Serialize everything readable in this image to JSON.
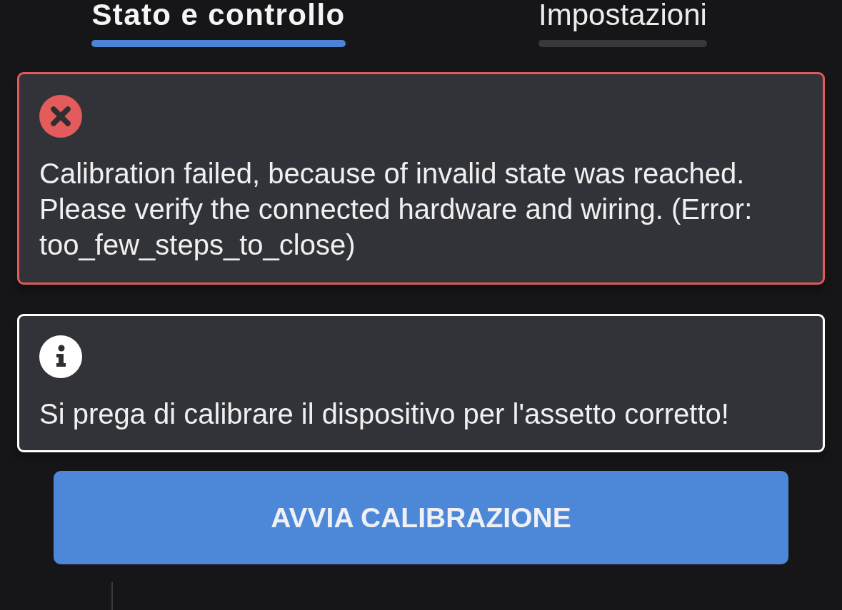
{
  "tabs": [
    {
      "label": "Stato e controllo",
      "selected": true
    },
    {
      "label": "Impostazioni",
      "selected": false
    }
  ],
  "alerts": [
    {
      "kind": "error",
      "message": "Calibration failed, because of invalid state was reached. Please verify the connected hardware and wiring. (Error: too_few_steps_to_close)"
    },
    {
      "kind": "info",
      "message": "Si prega di calibrare il dispositivo per l'assetto corretto!"
    }
  ],
  "primary_button": {
    "label": "AVVIA CALIBRAZIONE"
  }
}
